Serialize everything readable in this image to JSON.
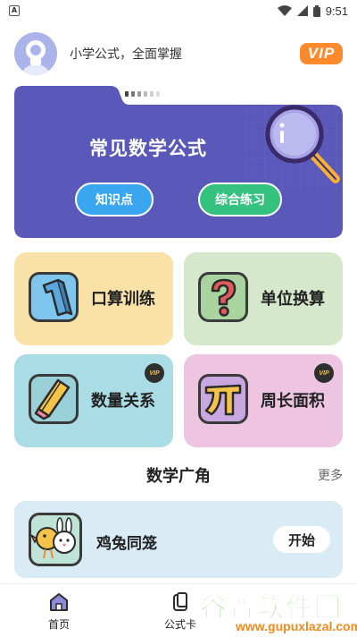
{
  "status_bar": {
    "time": "9:51",
    "left_icon": "android-notification-icon",
    "icons": [
      "wifi-icon",
      "signal-icon",
      "battery-icon"
    ]
  },
  "header": {
    "slogan": "小学公式，全面掌握",
    "vip_label": "VIP"
  },
  "banner": {
    "title": "常见数学公式",
    "buttons": [
      {
        "label": "知识点"
      },
      {
        "label": "综合练习"
      }
    ],
    "page_indicator": {
      "count": 6,
      "active": 0
    },
    "colors": {
      "background": "#5a58b8",
      "knowledge_button": "#3aa6f0",
      "practice_button": "#35c27e"
    }
  },
  "cards": [
    {
      "label": "口算训练",
      "icon": "number-one-icon",
      "vip": false,
      "color": "#f8e2a8"
    },
    {
      "label": "单位换算",
      "icon": "question-mark-icon",
      "vip": false,
      "color": "#d6e8cc"
    },
    {
      "label": "数量关系",
      "icon": "pencil-icon",
      "vip": true,
      "vip_label": "VIP",
      "color": "#a9dce4"
    },
    {
      "label": "周长面积",
      "icon": "pi-icon",
      "vip": true,
      "vip_label": "VIP",
      "color": "#edc5e1"
    }
  ],
  "section": {
    "title": "数学广角",
    "more": "更多"
  },
  "games": [
    {
      "label": "鸡兔同笼",
      "button": "开始",
      "icon": "chicken-rabbit-icon"
    }
  ],
  "bottom_nav": [
    {
      "label": "首页",
      "icon": "home-icon",
      "active": true
    },
    {
      "label": "公式卡",
      "icon": "formula-card-icon",
      "active": false
    }
  ],
  "watermark": {
    "title": "谷普软件园",
    "url": "www.gupuxlazal.com"
  }
}
